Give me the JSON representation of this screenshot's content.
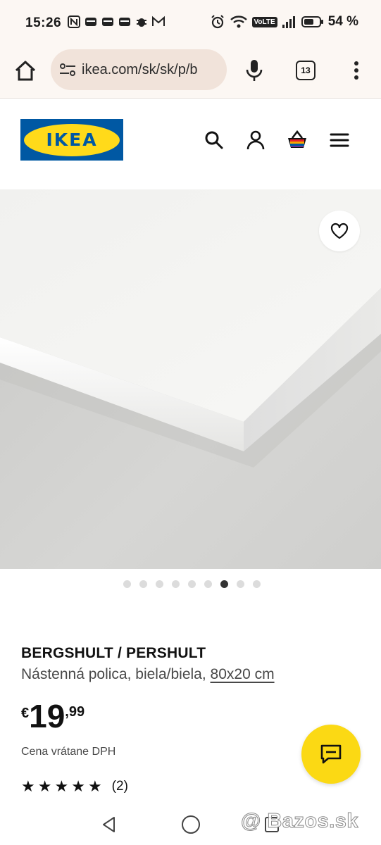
{
  "status_bar": {
    "time": "15:26",
    "battery": "54 %",
    "network": "VoLTE"
  },
  "browser": {
    "url": "ikea.com/sk/sk/p/b",
    "tab_count": "13"
  },
  "site": {
    "logo_text": "IKEA",
    "brand_blue": "#0058a3",
    "brand_yellow": "#ffda1a"
  },
  "carousel": {
    "dot_count": 9,
    "active_index": 6
  },
  "product": {
    "name": "BERGSHULT / PERSHULT",
    "description": "Nástenná polica, biela/biela,",
    "dimensions": "80x20 cm",
    "currency": "€",
    "price_whole": "19",
    "price_cents": ",99",
    "vat_note": "Cena vrátane DPH",
    "rating_stars": 5,
    "review_count": "(2)"
  },
  "watermark": "@ Bazos.sk"
}
